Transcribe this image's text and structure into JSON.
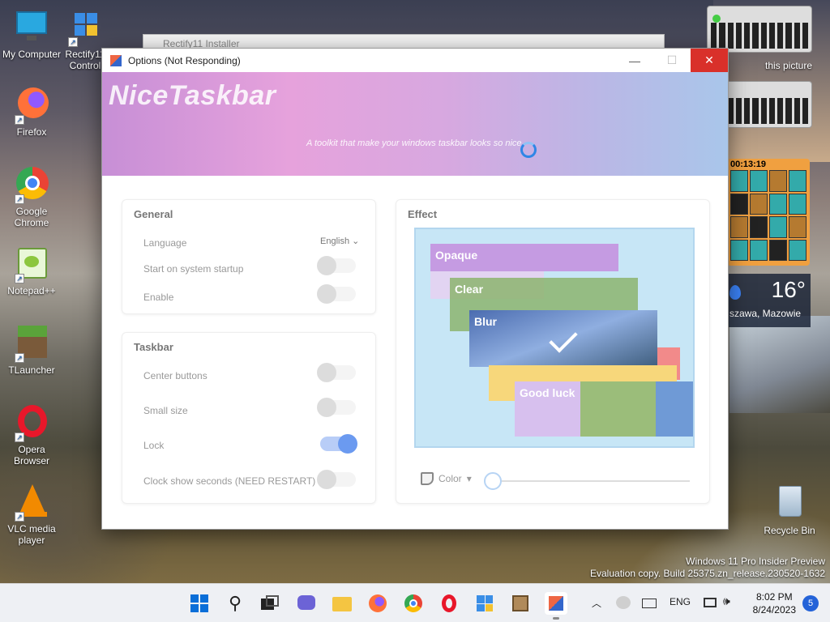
{
  "desktop": {
    "icons": [
      {
        "label": "My Computer"
      },
      {
        "label": "Rectify11 Control"
      },
      {
        "label": "Firefox"
      },
      {
        "label": "Google Chrome"
      },
      {
        "label": "Notepad++"
      },
      {
        "label": "TLauncher"
      },
      {
        "label": "Opera Browser"
      },
      {
        "label": "VLC media player"
      }
    ],
    "recycle_bin": "Recycle Bin",
    "partial_label": "this picture"
  },
  "gadgets": {
    "puzzle_time": "00:13:19",
    "weather_temp": "16°",
    "weather_location": "szawa, Mazowie"
  },
  "watermark": {
    "line1": "Windows 11 Pro Insider Preview",
    "line2": "Evaluation copy. Build 25375.zn_release.230520-1632"
  },
  "background_window": {
    "title": "Rectify11 Installer"
  },
  "window": {
    "title": "Options (Not Responding)",
    "banner_title": "NiceTaskbar",
    "banner_tagline": "A toolkit that make your windows taskbar looks so nice",
    "general": {
      "heading": "General",
      "language_label": "Language",
      "language_value": "English",
      "startup_label": "Start on system startup",
      "enable_label": "Enable"
    },
    "taskbar": {
      "heading": "Taskbar",
      "center_label": "Center buttons",
      "small_label": "Small size",
      "lock_label": "Lock",
      "seconds_label": "Clock show seconds (NEED RESTART)"
    },
    "effect": {
      "heading": "Effect",
      "opaque": "Opaque",
      "clear": "Clear",
      "blur": "Blur",
      "good_luck": "Good luck",
      "color_label": "Color",
      "slider_value": 0
    },
    "toggles": {
      "startup": false,
      "enable": false,
      "center": false,
      "small": false,
      "lock": true,
      "seconds": false
    }
  },
  "taskbar": {
    "language": "ENG",
    "time": "8:02 PM",
    "date": "8/24/2023",
    "notifications": "5"
  }
}
